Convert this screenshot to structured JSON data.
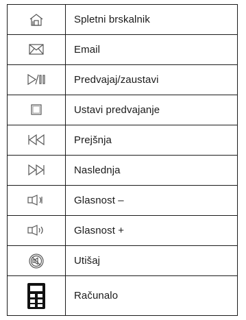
{
  "keys": [
    {
      "icon": "home-icon",
      "label": "Spletni brskalnik"
    },
    {
      "icon": "envelope-icon",
      "label": "Email"
    },
    {
      "icon": "play-pause-icon",
      "label": "Predvajaj/zaustavi"
    },
    {
      "icon": "stop-icon",
      "label": "Ustavi predvajanje"
    },
    {
      "icon": "previous-track-icon",
      "label": "Prejšnja"
    },
    {
      "icon": "next-track-icon",
      "label": "Naslednja"
    },
    {
      "icon": "volume-down-icon",
      "label": "Glasnost –"
    },
    {
      "icon": "volume-up-icon",
      "label": "Glasnost +"
    },
    {
      "icon": "mute-icon",
      "label": "Utišaj"
    },
    {
      "icon": "calculator-icon",
      "label": "Računalo"
    }
  ]
}
